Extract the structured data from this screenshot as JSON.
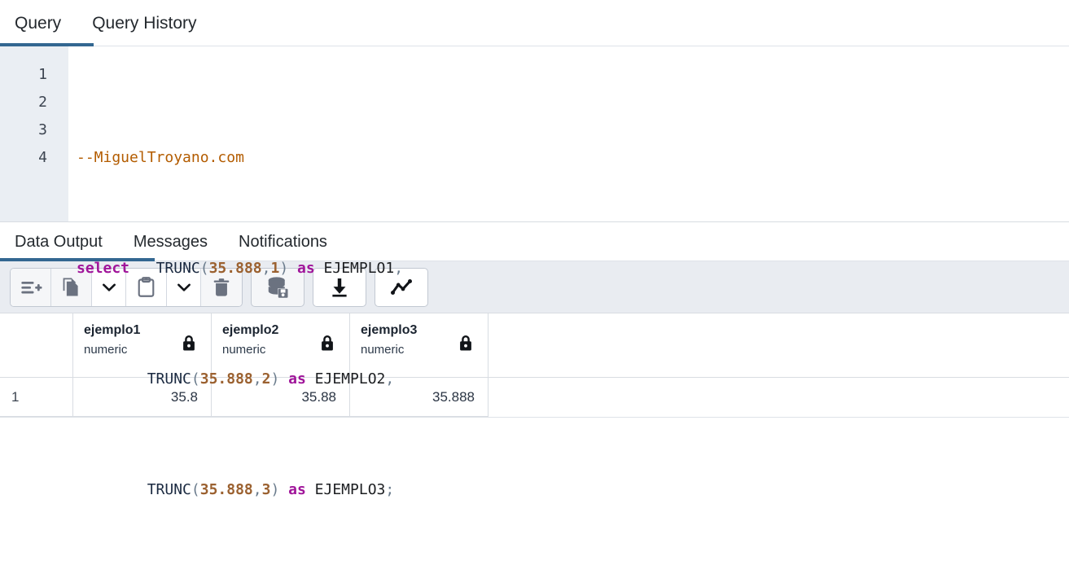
{
  "editor_tabs": {
    "items": [
      {
        "label": "Query",
        "active": true
      },
      {
        "label": "Query History",
        "active": false
      }
    ]
  },
  "sql_editor": {
    "line_numbers": [
      "1",
      "2",
      "3",
      "4"
    ],
    "lines": [
      {
        "n": "1",
        "raw": "--MiguelTroyano.com"
      },
      {
        "n": "2",
        "raw": "select  TRUNC(35.888,1) as EJEMPLO1,"
      },
      {
        "n": "3",
        "raw": "        TRUNC(35.888,2) as EJEMPLO2,"
      },
      {
        "n": "4",
        "raw": "        TRUNC(35.888,3) as EJEMPLO3;"
      }
    ],
    "tokens": {
      "comment": "--MiguelTroyano.com",
      "kw_select": "select",
      "kw_as": "as",
      "fn_trunc": "TRUNC",
      "num_value": "35.888",
      "precision_1": "1",
      "precision_2": "2",
      "precision_3": "3",
      "alias_1": "EJEMPLO1",
      "alias_2": "EJEMPLO2",
      "alias_3": "EJEMPLO3",
      "indent": "        ",
      "sel_gap": "  ",
      "open_paren": "(",
      "close_paren": ")",
      "comma": ",",
      "semicolon": ";",
      "space": " "
    },
    "colors": {
      "comment": "#b35c00",
      "keyword": "#a0159a",
      "function": "#1b2a41",
      "number": "#9b6130",
      "punctuation": "#6a7b8c",
      "identifier": "#1c1e21",
      "gutter_bg": "#eaeef3"
    }
  },
  "output_tabs": {
    "items": [
      {
        "label": "Data Output",
        "active": true
      },
      {
        "label": "Messages",
        "active": false
      },
      {
        "label": "Notifications",
        "active": false
      }
    ]
  },
  "result_toolbar": {
    "buttons": [
      {
        "name": "add-row-icon",
        "title": "Add row",
        "enabled": false
      },
      {
        "name": "copy-icon",
        "title": "Copy",
        "enabled": false
      },
      {
        "name": "copy-options-chevron-down-icon",
        "title": "Copy options",
        "enabled": true
      },
      {
        "name": "paste-icon",
        "title": "Paste",
        "enabled": true
      },
      {
        "name": "paste-options-chevron-down-icon",
        "title": "Paste options",
        "enabled": true
      },
      {
        "name": "delete-icon",
        "title": "Delete",
        "enabled": false
      },
      {
        "name": "save-data-changes-icon",
        "title": "Save data changes",
        "enabled": false
      },
      {
        "name": "download-icon",
        "title": "Download as CSV",
        "enabled": true
      },
      {
        "name": "graph-visualiser-icon",
        "title": "Graph Visualiser",
        "enabled": true
      }
    ]
  },
  "result_grid": {
    "row_header_label": "",
    "columns": [
      {
        "name": "ejemplo1",
        "type": "numeric",
        "lock": true
      },
      {
        "name": "ejemplo2",
        "type": "numeric",
        "lock": true
      },
      {
        "name": "ejemplo3",
        "type": "numeric",
        "lock": true
      }
    ],
    "rows": [
      {
        "index": "1",
        "values": [
          "35.8",
          "35.88",
          "35.888"
        ]
      }
    ]
  },
  "theme": {
    "accent": "#336791",
    "toolbar_bg": "#e9ecf1",
    "border": "#d8dce2",
    "page_bg": "#ffffff"
  }
}
